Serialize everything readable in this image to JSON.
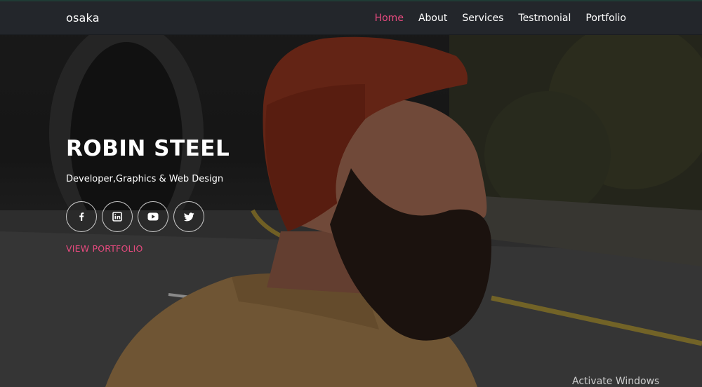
{
  "brand": "osaka",
  "nav": {
    "items": [
      {
        "label": "Home",
        "active": true
      },
      {
        "label": "About",
        "active": false
      },
      {
        "label": "Services",
        "active": false
      },
      {
        "label": "Testmonial",
        "active": false
      },
      {
        "label": "Portfolio",
        "active": false
      }
    ]
  },
  "hero": {
    "title": "ROBIN STEEL",
    "subtitle": "Developer,Graphics & Web Design",
    "socials": [
      {
        "name": "facebook-icon",
        "icon": "f"
      },
      {
        "name": "linkedin-icon",
        "icon": "in"
      },
      {
        "name": "youtube-icon",
        "icon": "play"
      },
      {
        "name": "twitter-icon",
        "icon": "bird"
      }
    ],
    "cta_label": "VIEW PORTFOLIO"
  },
  "watermark": "Activate Windows",
  "colors": {
    "accent": "#e84a7f",
    "navbar_bg": "#23262b",
    "text": "#ffffff"
  }
}
